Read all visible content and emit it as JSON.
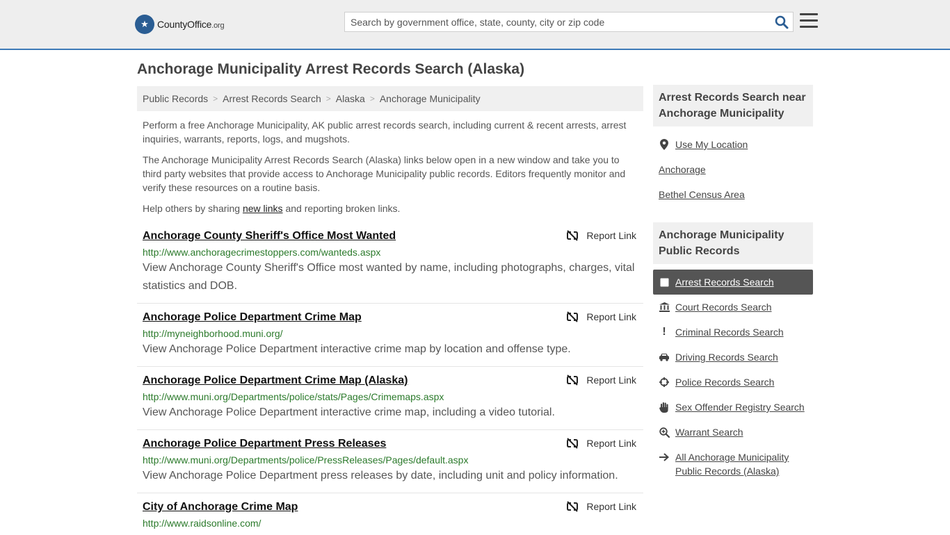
{
  "header": {
    "logo_text": "CountyOffice",
    "logo_tld": ".org",
    "search_placeholder": "Search by government office, state, county, city or zip code",
    "accent": "#3d7ab7"
  },
  "page": {
    "title": "Anchorage Municipality Arrest Records Search (Alaska)"
  },
  "breadcrumb": [
    "Public Records",
    "Arrest Records Search",
    "Alaska",
    "Anchorage Municipality"
  ],
  "intro": {
    "p1": "Perform a free Anchorage Municipality, AK public arrest records search, including current & recent arrests, arrest inquiries, warrants, reports, logs, and mugshots.",
    "p2": "The Anchorage Municipality Arrest Records Search (Alaska) links below open in a new window and take you to third party websites that provide access to Anchorage Municipality public records. Editors frequently monitor and verify these resources on a routine basis.",
    "p3_before": "Help others by sharing ",
    "p3_link": "new links",
    "p3_after": " and reporting broken links."
  },
  "report_label": "Report Link",
  "results": [
    {
      "title": "Anchorage County Sheriff's Office Most Wanted",
      "url": "http://www.anchoragecrimestoppers.com/wanteds.aspx",
      "desc": "View Anchorage County Sheriff's Office most wanted by name, including photographs, charges, vital statistics and DOB."
    },
    {
      "title": "Anchorage Police Department Crime Map",
      "url": "http://myneighborhood.muni.org/",
      "desc": "View Anchorage Police Department interactive crime map by location and offense type."
    },
    {
      "title": "Anchorage Police Department Crime Map (Alaska)",
      "url": "http://www.muni.org/Departments/police/stats/Pages/Crimemaps.aspx",
      "desc": "View Anchorage Police Department interactive crime map, including a video tutorial."
    },
    {
      "title": "Anchorage Police Department Press Releases",
      "url": "http://www.muni.org/Departments/police/PressReleases/Pages/default.aspx",
      "desc": "View Anchorage Police Department press releases by date, including unit and policy information."
    },
    {
      "title": "City of Anchorage Crime Map",
      "url": "http://www.raidsonline.com/",
      "desc": ""
    }
  ],
  "sidebar": {
    "near_heading": "Arrest Records Search near Anchorage Municipality",
    "near_items": [
      {
        "label": "Use My Location",
        "icon": "location-pin-icon"
      },
      {
        "label": "Anchorage"
      },
      {
        "label": "Bethel Census Area"
      }
    ],
    "records_heading": "Anchorage Municipality Public Records",
    "records_items": [
      {
        "label": "Arrest Records Search",
        "icon": "square-icon",
        "active": true
      },
      {
        "label": "Court Records Search",
        "icon": "courthouse-icon"
      },
      {
        "label": "Criminal Records Search",
        "icon": "exclamation-icon"
      },
      {
        "label": "Driving Records Search",
        "icon": "car-icon"
      },
      {
        "label": "Police Records Search",
        "icon": "crosshair-icon"
      },
      {
        "label": "Sex Offender Registry Search",
        "icon": "hand-icon"
      },
      {
        "label": "Warrant Search",
        "icon": "magnifier-plus-icon"
      },
      {
        "label": "All Anchorage Municipality Public Records (Alaska)",
        "icon": "arrow-right-icon"
      }
    ]
  }
}
